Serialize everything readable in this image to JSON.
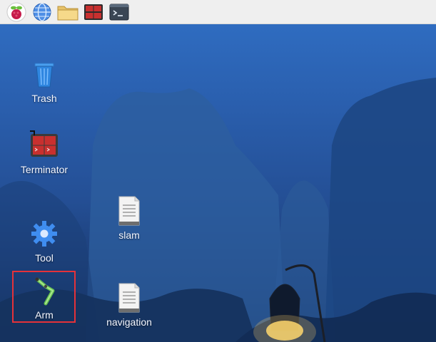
{
  "taskbar": {
    "items": [
      {
        "name": "raspberry-menu"
      },
      {
        "name": "web-browser"
      },
      {
        "name": "file-manager"
      },
      {
        "name": "terminator-launcher"
      },
      {
        "name": "terminal-launcher"
      }
    ]
  },
  "desktop": {
    "icons": [
      {
        "label": "Trash",
        "icon": "trash-icon"
      },
      {
        "label": "Terminator",
        "icon": "terminator-icon"
      },
      {
        "label": "Tool",
        "icon": "gear-icon"
      },
      {
        "label": "Arm",
        "icon": "robot-arm-icon",
        "selected": true
      },
      {
        "label": "slam",
        "icon": "text-file-icon"
      },
      {
        "label": "navigation",
        "icon": "text-file-icon"
      }
    ]
  },
  "colors": {
    "selection_border": "#e53239",
    "desktop_top": "#2f6cc0",
    "desktop_bottom": "#12284d"
  }
}
